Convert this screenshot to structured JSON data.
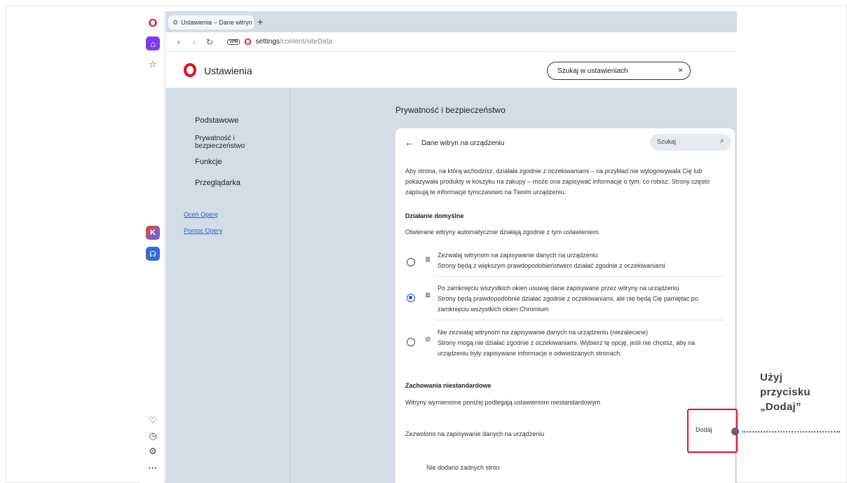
{
  "tab": {
    "label": "Ustawienia – Dane witryn",
    "new_tab": "+"
  },
  "address": {
    "vpn": "VPN",
    "url_main": "settings",
    "url_rest": "/content/siteData"
  },
  "header": {
    "title": "Ustawienia",
    "search_value": "Szukaj w ustawieniach",
    "clear": "×"
  },
  "nav": {
    "podstawowe": "Podstawowe",
    "prywatnosc_line1": "Prywatność i",
    "prywatnosc_line2": "bezpieczeństwo",
    "funkcje": "Funkcje",
    "przegladarka": "Przeglądarka",
    "ocen": "Oceń Operę",
    "pomoc": "Pomoc Opery"
  },
  "content": {
    "section_title": "Prywatność i bezpieczeństwo",
    "card_title": "Dane witryn na urządzeniu",
    "card_search": "Szukaj",
    "desc_line1": "Aby strona, na którą wchodzisz, działała zgodnie z oczekiwaniami – na przykład nie wylogowywała Cię lub",
    "desc_line2": "pokazywała produkty w koszyku na zakupy – może ona zapisywać informacje o tym, co robisz. Strony często",
    "desc_line3": "zapisują te informacje tymczasowo na Twoim urządzeniu.",
    "default_heading": "Działanie domyślne",
    "default_desc": "Otwierane witryny automatycznie działają zgodnie z tym ustawieniem.",
    "options": [
      {
        "line1": "Zezwalaj witrynom na zapisywanie danych na urządzeniu",
        "line2": "Strony będą z większym prawdopodobieństwem działać zgodnie z oczekiwaniami",
        "line3": ""
      },
      {
        "line1": "Po zamknięciu wszystkich okien usuwaj dane zapisywane przez witryny na urządzeniu",
        "line2": "Strony będą prawdopodobnie działać zgodnie z oczekiwaniami, ale nie będą Cię pamiętać po",
        "line3": "zamknięciu wszystkich okien Chromium"
      },
      {
        "line1": "Nie zezwalaj witrynom na zapisywanie danych na urządzeniu (niezalecane)",
        "line2": "Strony mogą nie działać zgodnie z oczekiwaniami. Wybierz tę opcję, jeśli nie chcesz, aby na",
        "line3": "urządzeniu były zapisywane informacje o odwiedzanych stronach."
      }
    ],
    "selected_option": 1,
    "custom_heading": "Zachowania niestandardowe",
    "custom_desc": "Witryny wymienione poniżej podlegają ustawieniom niestandardowym",
    "allowed_label": "Zezwolono na zapisywanie danych na urządzeniu",
    "add_button": "Dodaj",
    "no_sites": "Nie dodano żadnych stron"
  },
  "annotation": {
    "line1": "Użyj",
    "line2": "przycisku",
    "line3": "„Dodaj”"
  },
  "icons": [
    "opera-logo-icon",
    "home-icon",
    "star-icon",
    "app-icon",
    "headphones-icon",
    "heart-icon",
    "history-icon",
    "settings-icon",
    "more-icon",
    "back-icon",
    "forward-icon",
    "reload-icon",
    "search-icon",
    "database-icon",
    "database-off-icon"
  ],
  "colors": {
    "opera_red": "#e00e20",
    "accent_blue": "#1a56d6",
    "highlight_red": "#e0102a",
    "page_bg": "#d3dde6"
  }
}
